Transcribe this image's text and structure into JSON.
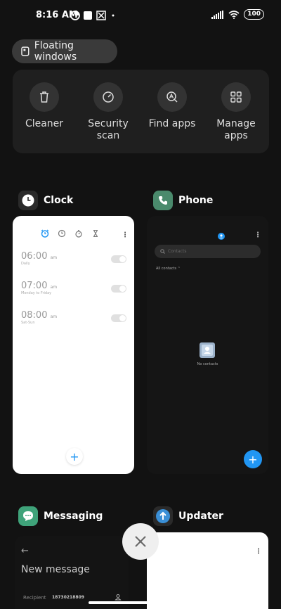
{
  "status": {
    "time": "8:16 AM",
    "battery": "100"
  },
  "floating_windows": {
    "label": "Floating windows"
  },
  "tools": [
    {
      "label": "Cleaner",
      "icon": "trash-icon"
    },
    {
      "label": "Security\nscan",
      "icon": "security-scan-icon"
    },
    {
      "label": "Find apps",
      "icon": "find-apps-icon"
    },
    {
      "label": "Manage\napps",
      "icon": "grid-icon"
    }
  ],
  "apps": {
    "clock": {
      "name": "Clock",
      "alarms": [
        {
          "time": "06:00",
          "ampm": "am",
          "repeat": "Daily"
        },
        {
          "time": "07:00",
          "ampm": "am",
          "repeat": "Monday to Friday"
        },
        {
          "time": "08:00",
          "ampm": "am",
          "repeat": "Sat-Sun"
        }
      ]
    },
    "phone": {
      "name": "Phone",
      "search_placeholder": "Contacts",
      "filter": "All contacts",
      "empty": "No contacts"
    },
    "messaging": {
      "name": "Messaging",
      "title": "New message",
      "recipient_label": "Recipient",
      "recipient_value": "18730218809"
    },
    "updater": {
      "name": "Updater"
    }
  },
  "colors": {
    "accent": "#2196f3",
    "background": "#121212",
    "phone_icon": "#4a8a6c",
    "messaging_icon": "#3fa37a",
    "updater_icon": "#3a8fd6"
  }
}
